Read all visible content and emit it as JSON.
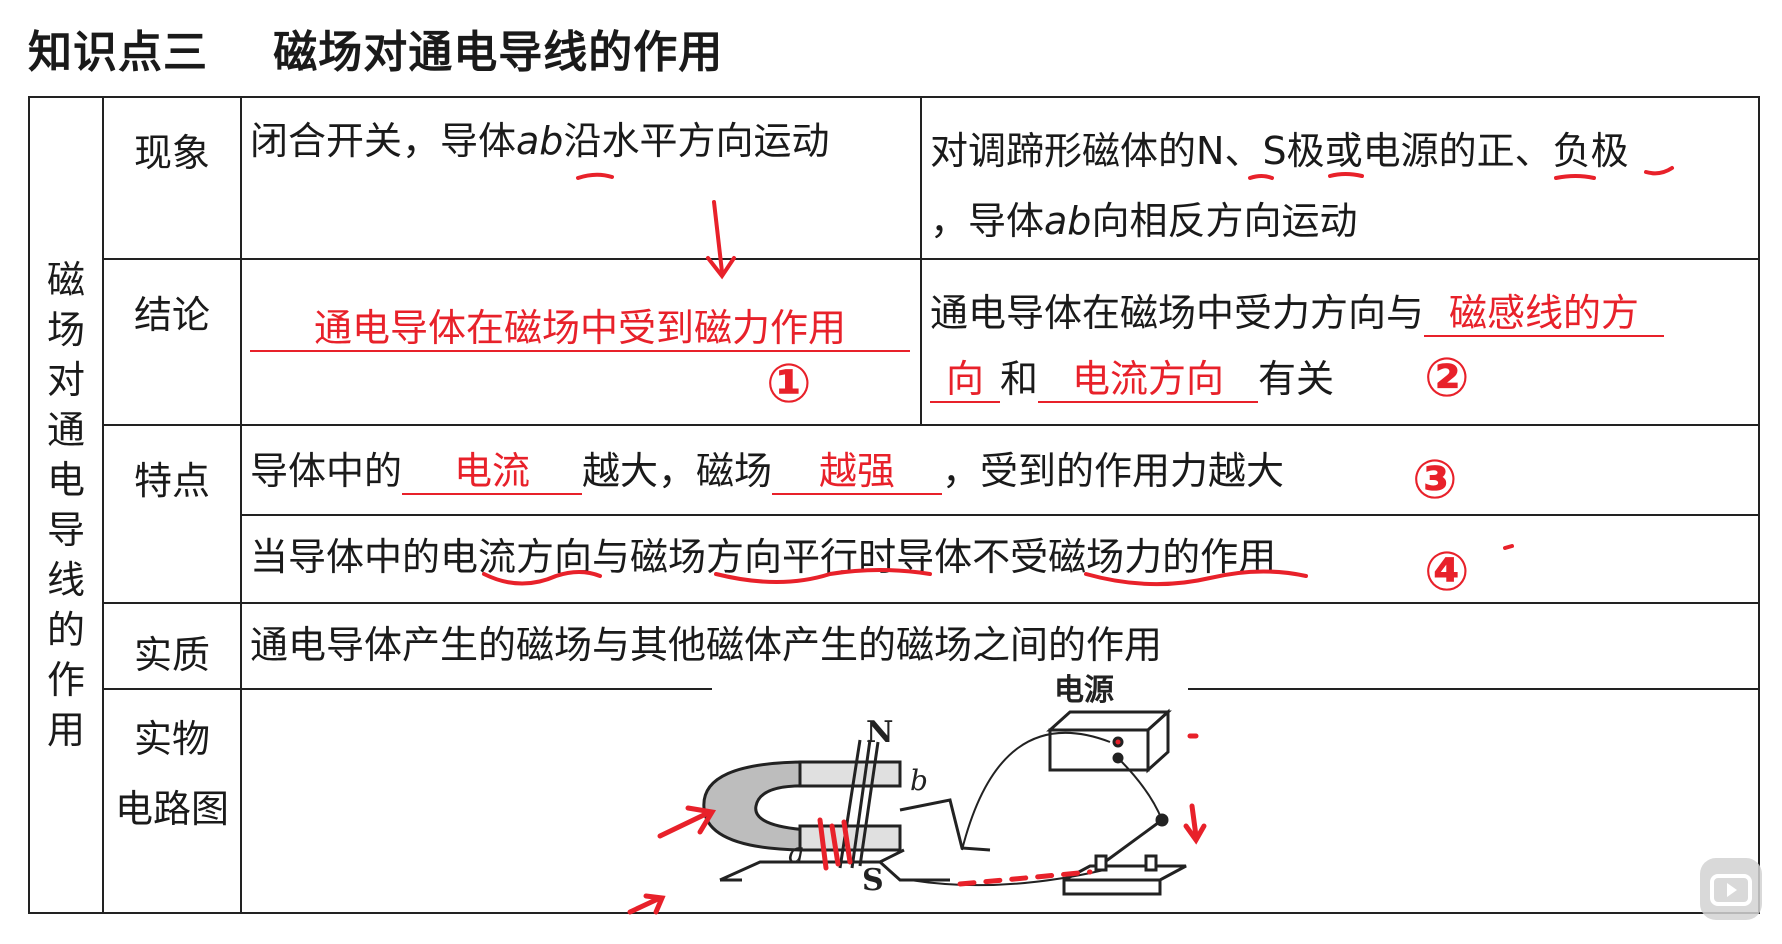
{
  "title": "知识点三    磁场对通电导线的作用",
  "side_label": [
    "磁",
    "场",
    "对",
    "通",
    "电",
    "导",
    "线",
    "的",
    "作",
    "用"
  ],
  "rows": {
    "phenomenon": {
      "label": "现象",
      "left_prefix": "闭合开关，导体",
      "left_ab": "ab",
      "left_suffix": "沿水平方向运动",
      "right_1": "对调蹄形磁体的",
      "right_N": "N",
      "right_2": "、",
      "right_S": "S",
      "right_3": "极或电源的",
      "right_zheng": "正",
      "right_4": "、",
      "right_fu": "负",
      "right_5": "极",
      "right_line2_prefix": "，导体",
      "right_line2_ab": "ab",
      "right_line2_suffix": "向相反方向运动"
    },
    "conclusion": {
      "label": "结论",
      "left_answer": "通电导体在磁场中受到磁力作用",
      "right_prefix": "通电导体在磁场中受力方向与",
      "right_answer1a": "磁感线的方",
      "right_answer1b": "向",
      "right_mid": "和",
      "right_answer2": "电流方向",
      "right_suffix": "有关"
    },
    "feature": {
      "label": "特点",
      "l1_a": "导体中的",
      "l1_ans1": "电流",
      "l1_b": "越大，磁场",
      "l1_ans2": "越强",
      "l1_c": "，受到的作用力越大",
      "l2_a": "当导体中的",
      "l2_b": "电流方向",
      "l2_c": "与",
      "l2_d": "磁场方向平行",
      "l2_e": "时导体",
      "l2_f": "不受磁场力",
      "l2_g": "的作用"
    },
    "essence": {
      "label": "实质",
      "text": "通电导体产生的磁场与其他磁体产生的磁场之间的作用"
    },
    "diagram": {
      "label_1": "实物",
      "label_2": "电路图",
      "power_label": "电源",
      "pole_N": "N",
      "pole_S": "S",
      "wire_a": "a",
      "wire_b": "b"
    }
  },
  "annotations": {
    "m1": "①",
    "m2": "②",
    "m3": "③",
    "m4": "④"
  },
  "colors": {
    "ink": "#1a1a1a",
    "red_pen": "#e8212a",
    "border": "#222222"
  },
  "icons": {
    "bilibili": "video-play-icon"
  }
}
